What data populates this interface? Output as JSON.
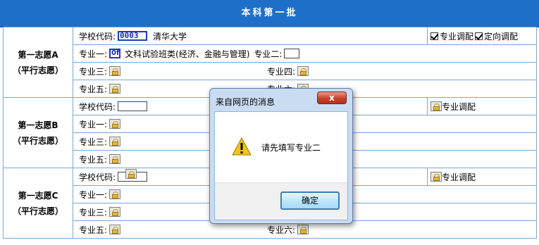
{
  "header": {
    "title": "本科第一批"
  },
  "labels": {
    "school_code": "学校代码:",
    "major1": "专业一:",
    "major2": "专业二:",
    "major3": "专业三:",
    "major4": "专业四:",
    "major5": "专业五:",
    "major6": "专业六:",
    "major_adjust": "专业调配",
    "directed_adjust": "定向调配"
  },
  "choices": [
    {
      "title": "第一志愿A",
      "subtitle": "（平行志愿）",
      "school_code": "0003",
      "school_name": "清华大学",
      "major1_code": "0f",
      "major1_name": "文科试验班类(经济、金融与管理)",
      "major_adjust_checked": true,
      "directed_adjust_checked": true
    },
    {
      "title": "第一志愿B",
      "subtitle": "（平行志愿）",
      "school_code": ""
    },
    {
      "title": "第一志愿C",
      "subtitle": "（平行志愿）",
      "school_code": ""
    }
  ],
  "dialog": {
    "title": "来自网页的消息",
    "close_label": "x",
    "message": "请先填写专业二",
    "ok_label": "确定",
    "icon": "warning-icon"
  },
  "colors": {
    "header_bg": "#1e6fc8",
    "grid_border": "#7aa6d6",
    "dialog_frame": "#c9dcf2",
    "close_red": "#c6412b"
  }
}
